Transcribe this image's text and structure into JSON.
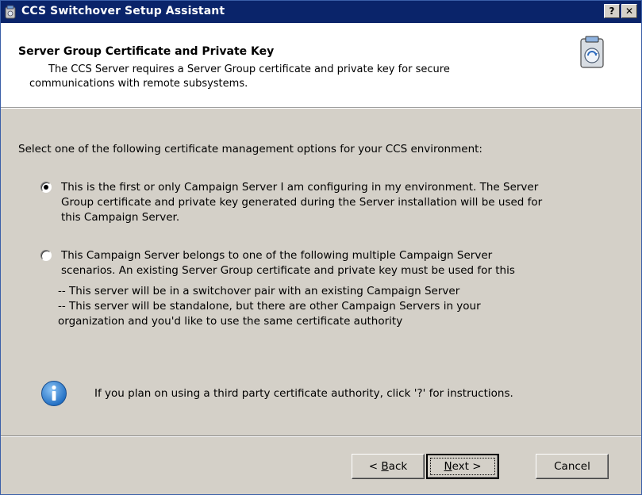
{
  "window": {
    "title": "CCS Switchover Setup Assistant",
    "help_label": "?",
    "close_label": "✕"
  },
  "header": {
    "title": "Server Group Certificate and Private Key",
    "description_line1": "The CCS Server requires a Server Group certificate and private key for secure",
    "description_line2": "communications with remote subsystems."
  },
  "prompt": "Select one of the following certificate management options for your CCS environment:",
  "options": [
    {
      "selected": true,
      "lines": [
        "This is the first or only Campaign Server I am configuring in my environment. The Server",
        "Group certificate and private key generated during the Server installation will be used for",
        "this Campaign Server."
      ]
    },
    {
      "selected": false,
      "lines": [
        "This Campaign Server belongs to one of the following multiple Campaign Server",
        "scenarios. An existing Server Group certificate and private key must be used for this"
      ]
    }
  ],
  "sub_lines": [
    "-- This server will be in a switchover pair with an existing Campaign Server",
    "-- This server will be standalone, but there are other Campaign Servers in your",
    "organization and you'd like to use the same certificate authority"
  ],
  "info_text": "If you plan on using a third party certificate authority, click '?' for instructions.",
  "buttons": {
    "back": "< Back",
    "next": "Next >",
    "cancel": "Cancel"
  },
  "colors": {
    "titlebar": "#0a246a",
    "dialog_face": "#d4d0c8",
    "header_bg": "#ffffff",
    "info_blue": "#2a7fd4"
  },
  "icons": [
    "app-icon",
    "wizard-icon",
    "info-icon"
  ]
}
